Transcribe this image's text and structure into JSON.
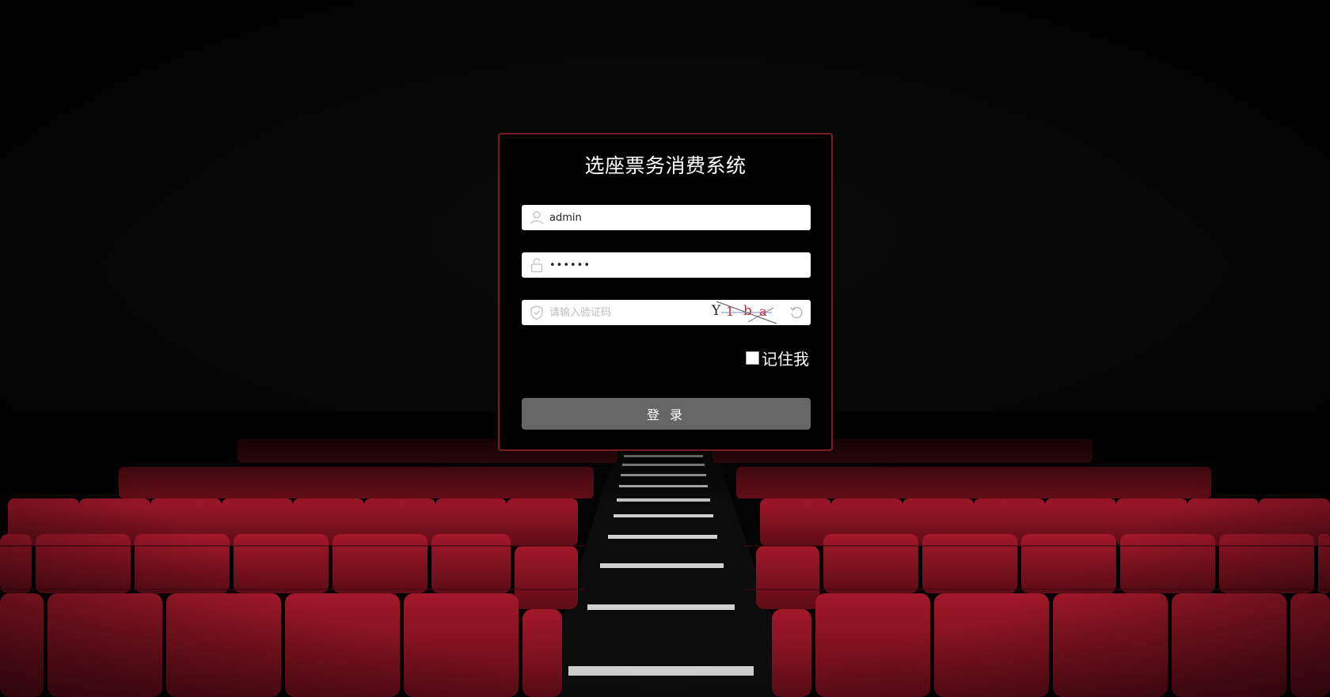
{
  "page": {
    "title": "选座票务消费系统"
  },
  "form": {
    "username_value": "admin",
    "password_value": "••••••",
    "captcha_placeholder": "请输入验证码",
    "captcha_chars": [
      "Y",
      "1",
      "b",
      "a"
    ],
    "remember_label": "记住我",
    "remember_checked": false,
    "login_label": "登 录"
  },
  "icons": {
    "username": "user-icon",
    "password": "lock-icon",
    "captcha": "shield-check-icon",
    "refresh": "refresh-icon"
  },
  "colors": {
    "seat_red": "#8b1420",
    "box_border": "#7a1a22",
    "button_bg": "#666666",
    "captcha_red": "#d0213b"
  }
}
